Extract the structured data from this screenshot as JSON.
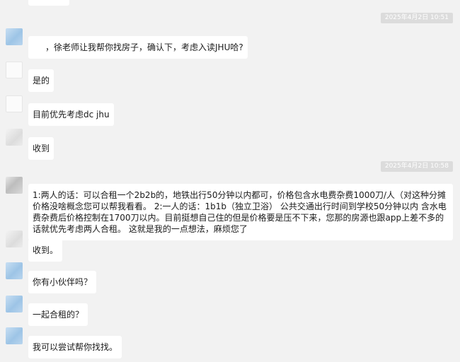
{
  "timestamps": [
    "2025年4月2日 10:51",
    "2025年4月2日 10:58"
  ],
  "messages": [
    {
      "text": "，徐老师让我帮你找房子，确认下，考虑入读JHU哈?"
    },
    {
      "text": "是的"
    },
    {
      "text": "目前优先考虑dc jhu"
    },
    {
      "text": "收到"
    },
    {
      "text": "1:两人的话：可以合租一个2b2b的，地铁出行50分钟以内都可，价格包含水电费杂费1000刀/人（对这种分摊价格没啥概念您可以帮我看看。 2:一人的话：1b1b（独立卫浴） 公共交通出行时间到学校50分钟以内 含水电费杂费后价格控制在1700刀以内。目前挺想自己住的但是价格要是压不下来，您那的房源也跟app上差不多的话就优先考虑两人合租。 这就是我的一点想法，麻烦您了"
    },
    {
      "text": "收到。"
    },
    {
      "text": "你有小伙伴吗？"
    },
    {
      "text": "一起合租的？"
    },
    {
      "text": "我可以尝试帮你找找。"
    }
  ],
  "colors": {
    "background": "#f2f2f2",
    "bubble": "#ffffff",
    "time_badge": "#dcdcdc"
  }
}
